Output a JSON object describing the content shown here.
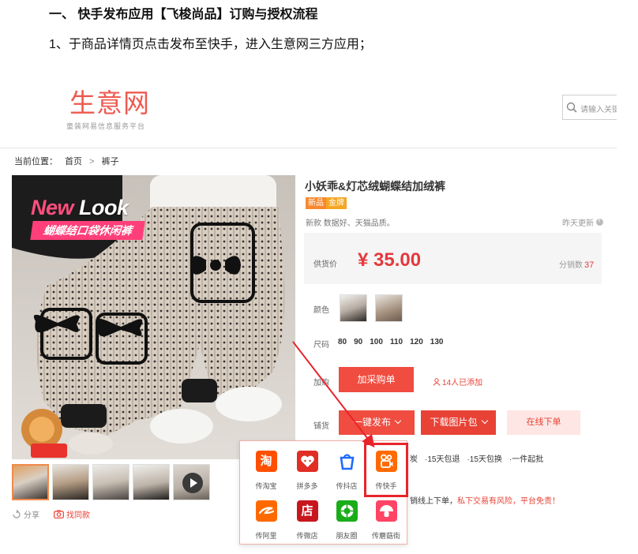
{
  "doc": {
    "heading": "一、 快手发布应用【飞梭尚品】订购与授权流程",
    "step1": "1、于商品详情页点击发布至快手，进入生意网三方应用；"
  },
  "site": {
    "logo": "生意网",
    "slogan": "童装网易信息服务平台",
    "search_placeholder": "请输入关键"
  },
  "breadcrumb": {
    "label": "当前位置：",
    "items": [
      "首页",
      "裤子"
    ],
    "sep": ">"
  },
  "gallery": {
    "new": "New",
    "look": "Look",
    "banner": "蝴蝶结口袋休闲裤",
    "share": "分享",
    "find_same": "找同款"
  },
  "product": {
    "title": "小妖乖&灯芯绒蝴蝶结加绒裤",
    "badges": [
      "新品",
      "金牌"
    ],
    "desc": "新款 数据好、天猫品质。",
    "updated": "昨天更新",
    "price_label": "供货价",
    "price": "¥ 35.00",
    "dist_label": "分销数",
    "dist_count": "37",
    "color_label": "颜色",
    "size_label": "尺码",
    "sizes": [
      "80",
      "90",
      "100",
      "110",
      "120",
      "130"
    ],
    "cart_label": "加购",
    "cart_button": "加采购单",
    "added": "14人已添加",
    "publish_label": "铺货",
    "publish_button": "一键发布",
    "download_button": "下载图片包",
    "order_button": "在线下单",
    "services": [
      "炭",
      "·15天包退",
      "·15天包换",
      "·一件起批"
    ],
    "notice_plain": "销线上下单，",
    "notice_red": "私下交易有风险，平台免责！"
  },
  "publish_menu": [
    {
      "label": "传淘宝",
      "icon": "taobao-icon",
      "glyph": "淘",
      "color": "#ff5000"
    },
    {
      "label": "拼多多",
      "icon": "pinduoduo-icon",
      "color": "#e02e24"
    },
    {
      "label": "传抖店",
      "icon": "douyin-store-icon",
      "color": "#1e6bff"
    },
    {
      "label": "传快手",
      "icon": "kuaishou-icon",
      "color": "#ff6a00"
    },
    {
      "label": "传阿里",
      "icon": "alibaba-icon",
      "color": "#ff6a00"
    },
    {
      "label": "传微店",
      "icon": "weidian-icon",
      "glyph": "店",
      "color": "#c8161d"
    },
    {
      "label": "朋友圈",
      "icon": "moments-icon",
      "color": "#1aad19"
    },
    {
      "label": "传蘑菇街",
      "icon": "mogujie-icon",
      "color": "#ff4466"
    }
  ],
  "colors": {
    "accent_red": "#f04c40",
    "price_red": "#e4393c",
    "logo": "#ee5a4f",
    "annotation": "#e8242b"
  }
}
